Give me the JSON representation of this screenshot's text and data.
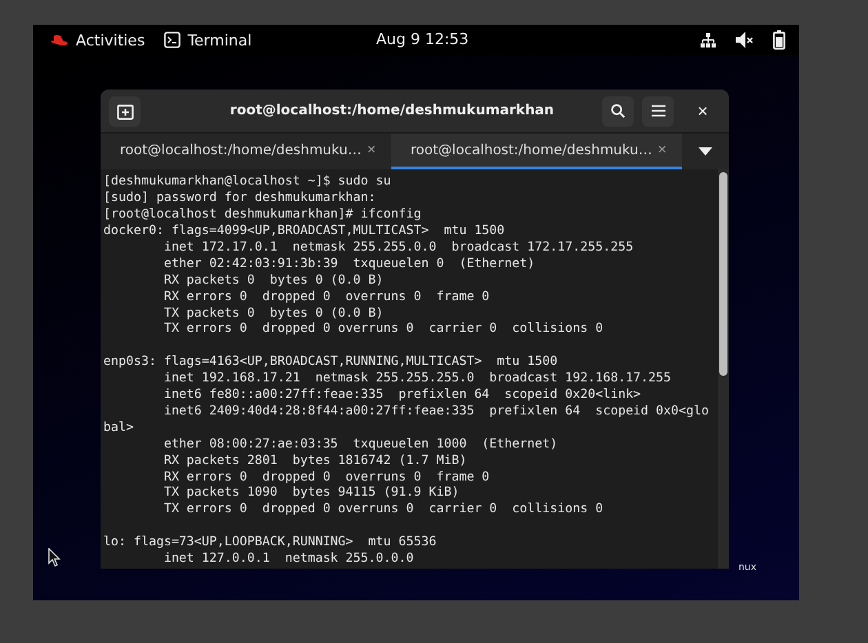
{
  "top_bar": {
    "activities": "Activities",
    "app_name": "Terminal",
    "clock": "Aug 9  12:53"
  },
  "window": {
    "title": "root@localhost:/home/deshmukumarkhan"
  },
  "tabs": [
    {
      "label": "root@localhost:/home/deshmuku…",
      "close": "×",
      "selected": false
    },
    {
      "label": "root@localhost:/home/deshmuku…",
      "close": "×",
      "selected": true
    }
  ],
  "close_button": "×",
  "output_blocks": [
    [
      "[deshmukumarkhan@localhost ~]$ sudo su",
      "[sudo] password for deshmukumarkhan:",
      "[root@localhost deshmukumarkhan]# ifconfig",
      "docker0: flags=4099<UP,BROADCAST,MULTICAST>  mtu 1500",
      "        inet 172.17.0.1  netmask 255.255.0.0  broadcast 172.17.255.255",
      "        ether 02:42:03:91:3b:39  txqueuelen 0  (Ethernet)",
      "        RX packets 0  bytes 0 (0.0 B)",
      "        RX errors 0  dropped 0  overruns 0  frame 0",
      "        TX packets 0  bytes 0 (0.0 B)",
      "        TX errors 0  dropped 0 overruns 0  carrier 0  collisions 0"
    ],
    [
      "enp0s3: flags=4163<UP,BROADCAST,RUNNING,MULTICAST>  mtu 1500",
      "        inet 192.168.17.21  netmask 255.255.255.0  broadcast 192.168.17.255",
      "        inet6 fe80::a00:27ff:feae:335  prefixlen 64  scopeid 0x20<link>",
      "        inet6 2409:40d4:28:8f44:a00:27ff:feae:335  prefixlen 64  scopeid 0x0<glo",
      "bal>",
      "        ether 08:00:27:ae:03:35  txqueuelen 1000  (Ethernet)",
      "        RX packets 2801  bytes 1816742 (1.7 MiB)",
      "        RX errors 0  dropped 0  overruns 0  frame 0",
      "        TX packets 1090  bytes 94115 (91.9 KiB)",
      "        TX errors 0  dropped 0 overruns 0  carrier 0  collisions 0"
    ],
    [
      "lo: flags=73<UP,LOOPBACK,RUNNING>  mtu 65536",
      "        inet 127.0.0.1  netmask 255.0.0.0"
    ]
  ],
  "desktop_label": "nux"
}
